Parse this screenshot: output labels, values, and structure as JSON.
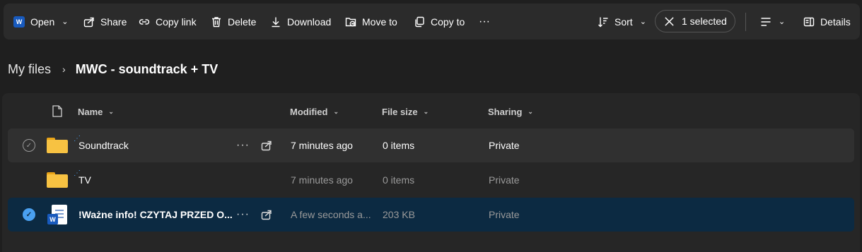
{
  "toolbar": {
    "open": "Open",
    "share": "Share",
    "copy_link": "Copy link",
    "delete": "Delete",
    "download": "Download",
    "move_to": "Move to",
    "copy_to": "Copy to",
    "more": "···",
    "sort": "Sort",
    "selected": "1 selected",
    "details": "Details"
  },
  "breadcrumb": {
    "root": "My files",
    "separator": "›",
    "current": "MWC - soundtrack + TV"
  },
  "columns": {
    "name": "Name",
    "modified": "Modified",
    "size": "File size",
    "sharing": "Sharing"
  },
  "files": [
    {
      "name": "Soundtrack",
      "modified": "7 minutes ago",
      "size": "0 items",
      "sharing": "Private",
      "more": "···"
    },
    {
      "name": "TV",
      "modified": "7 minutes ago",
      "size": "0 items",
      "sharing": "Private"
    },
    {
      "name": "!Ważne info! CZYTAJ PRZED O...",
      "modified": "A few seconds a...",
      "size": "203 KB",
      "sharing": "Private",
      "more": "···",
      "icon_letter": "W"
    }
  ],
  "colors": {
    "accent": "#4aa0f0",
    "selected_row": "#0c2a42",
    "word_blue": "#185abd"
  }
}
